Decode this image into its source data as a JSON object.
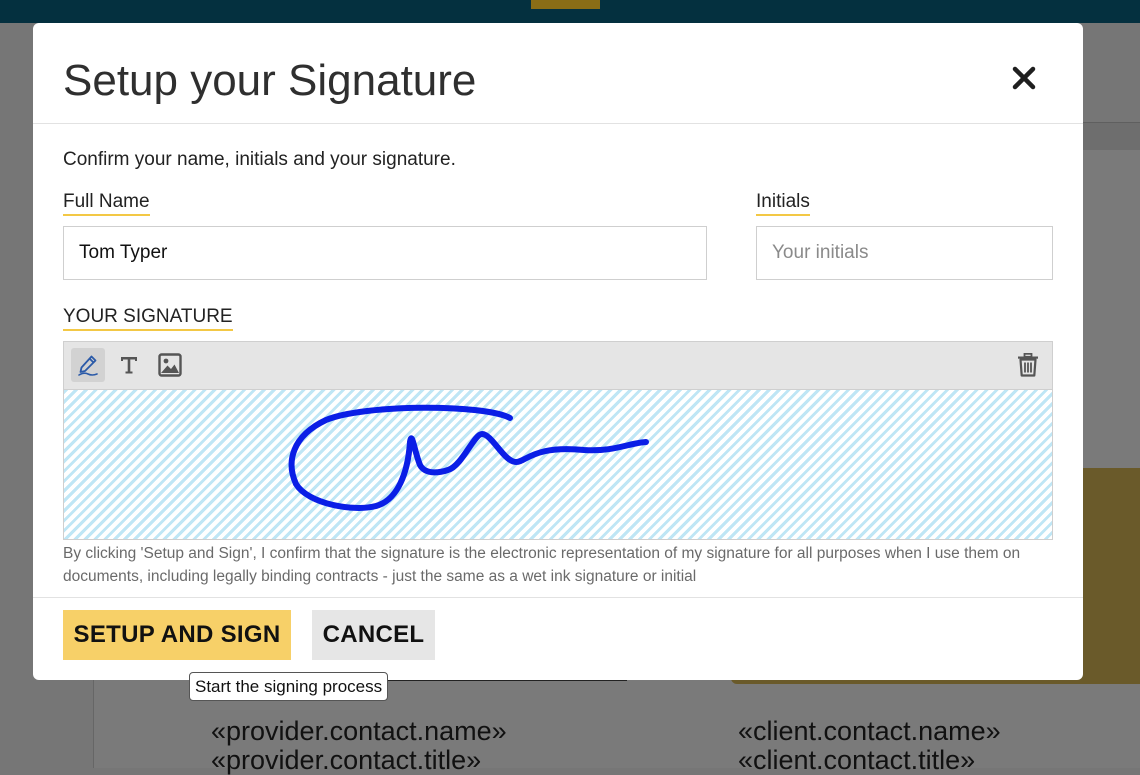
{
  "background": {
    "provider_name": "«provider.contact.name»",
    "provider_title": "«provider.contact.title»",
    "client_name": "«client.contact.name»",
    "client_title": "«client.contact.title»"
  },
  "modal": {
    "title": "Setup your Signature",
    "close_icon": "close-icon",
    "intro": "Confirm your name, initials and your signature.",
    "full_name": {
      "label": "Full Name",
      "value": "Tom Typer",
      "placeholder": ""
    },
    "initials": {
      "label": "Initials",
      "value": "",
      "placeholder": "Your initials"
    },
    "signature": {
      "label": "YOUR SIGNATURE",
      "tools": [
        "draw-icon",
        "text-icon",
        "image-icon"
      ],
      "active_tool": "draw-icon",
      "clear_icon": "trash-icon",
      "ink_color": "#0a1ee6"
    },
    "disclaimer": "By clicking 'Setup and Sign', I confirm that the signature is the electronic representation of my signature for all purposes when I use them on documents, including legally binding contracts - just the same as a wet ink signature or initial",
    "primary_button": "SETUP AND SIGN",
    "secondary_button": "CANCEL",
    "tooltip": "Start the signing process"
  },
  "colors": {
    "accent": "#f7d068",
    "label_underline": "#f3c845",
    "topbar": "#04303f"
  }
}
